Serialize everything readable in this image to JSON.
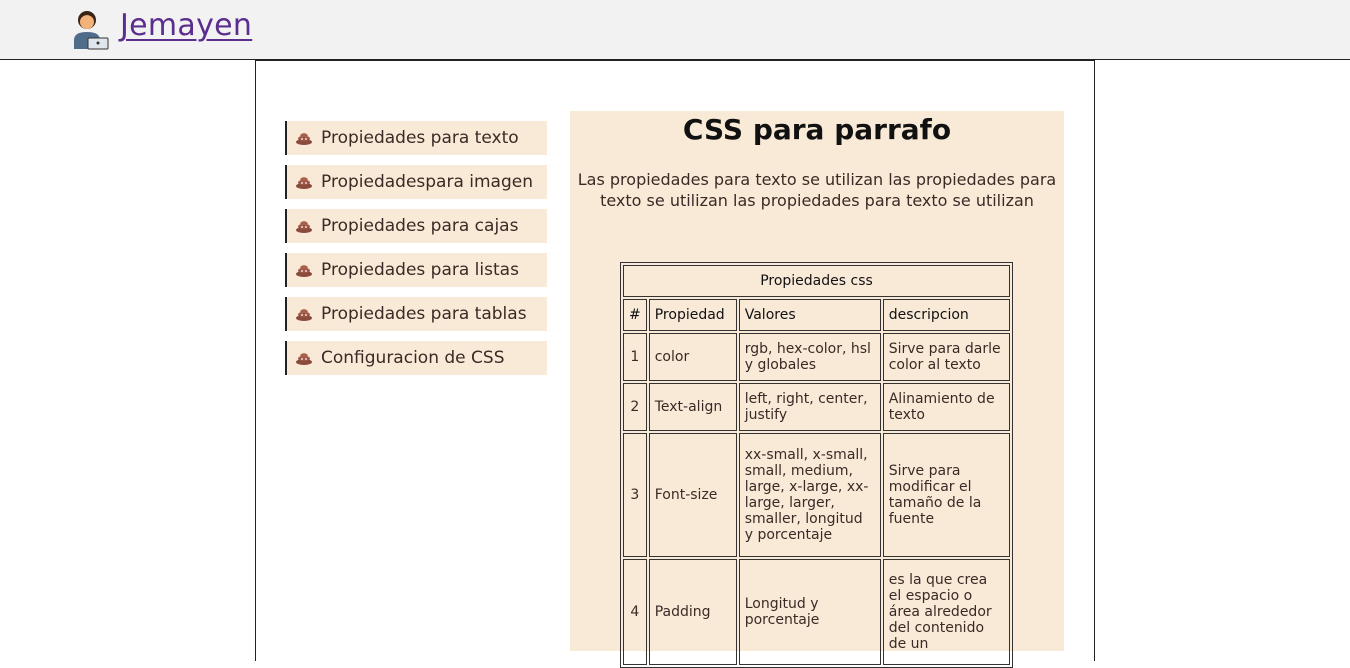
{
  "header": {
    "brand": "Jemayen",
    "logo_icon": "person-laptop-icon"
  },
  "sidebar": {
    "items": [
      {
        "label": "Propiedades para texto",
        "icon": "poop-emoji-icon"
      },
      {
        "label": "Propiedadespara imagen",
        "icon": "poop-emoji-icon"
      },
      {
        "label": "Propiedades para cajas",
        "icon": "poop-emoji-icon"
      },
      {
        "label": "Propiedades para listas",
        "icon": "poop-emoji-icon"
      },
      {
        "label": "Propiedades para tablas",
        "icon": "poop-emoji-icon"
      },
      {
        "label": "Configuracion de CSS",
        "icon": "poop-emoji-icon"
      }
    ]
  },
  "main": {
    "title": "CSS para parrafo",
    "paragraph": "Las propiedades para texto se utilizan las propiedades para texto se utilizan las propiedades para texto se utilizan",
    "table": {
      "caption": "Propiedades css",
      "headers": [
        "#",
        "Propiedad",
        "Valores",
        "descripcion"
      ],
      "rows": [
        [
          "1",
          "color",
          "rgb, hex-color, hsl y globales",
          "Sirve para darle color al texto"
        ],
        [
          "2",
          "Text-align",
          "left, right, center, justify",
          "Alinamiento de texto"
        ],
        [
          "3",
          "Font-size",
          "xx-small, x-small, small, medium, large, x-large, xx-large, larger, smaller, longitud y porcentaje",
          "Sirve para modificar el tamaño de la fuente"
        ],
        [
          "4",
          "Padding",
          "Longitud y porcentaje",
          "es la que crea el espacio o área alrededor del contenido de un"
        ]
      ]
    }
  },
  "colors": {
    "panel_bg": "#f9ead8",
    "brand_link": "#5b2d8e",
    "topbar_bg": "#f2f2f2"
  }
}
